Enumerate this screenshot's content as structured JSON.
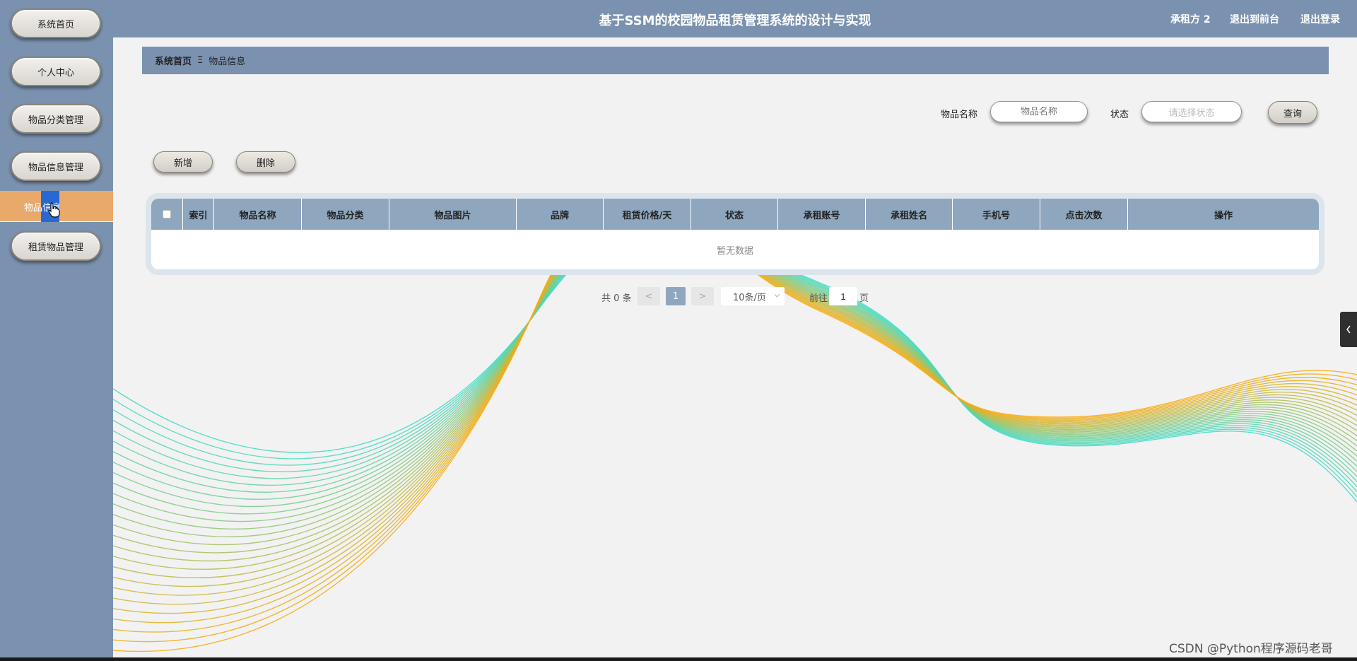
{
  "sidebar": {
    "items": [
      {
        "label": "系统首页"
      },
      {
        "label": "个人中心"
      },
      {
        "label": "物品分类管理"
      },
      {
        "label": "物品信息管理"
      },
      {
        "label": "租赁物品管理"
      }
    ],
    "active_label": "物品信息"
  },
  "header": {
    "title": "基于SSM的校园物品租赁管理系统的设计与实现",
    "user": "承租方 2",
    "to_front": "退出到前台",
    "logout": "退出登录"
  },
  "breadcrumb": {
    "home": "系统首页",
    "separator": "Ξ",
    "current": "物品信息"
  },
  "search": {
    "name_label": "物品名称",
    "name_placeholder": "物品名称",
    "status_label": "状态",
    "status_placeholder": "请选择状态",
    "query_button": "查询"
  },
  "actions": {
    "add": "新增",
    "delete": "删除"
  },
  "table": {
    "columns": [
      "索引",
      "物品名称",
      "物品分类",
      "物品图片",
      "品牌",
      "租赁价格/天",
      "状态",
      "承租账号",
      "承租姓名",
      "手机号",
      "点击次数",
      "操作"
    ],
    "empty_text": "暂无数据"
  },
  "pagination": {
    "total": "共 0 条",
    "prev": "<",
    "current_page": "1",
    "next": ">",
    "page_size": "10条/页",
    "goto_label": "前往",
    "goto_value": "1",
    "goto_suffix": "页"
  },
  "watermark": "CSDN @Python程序源码老哥",
  "colors": {
    "bar": "#7a92b0",
    "active": "#e9a96b",
    "table_header": "#8fa6bf"
  }
}
